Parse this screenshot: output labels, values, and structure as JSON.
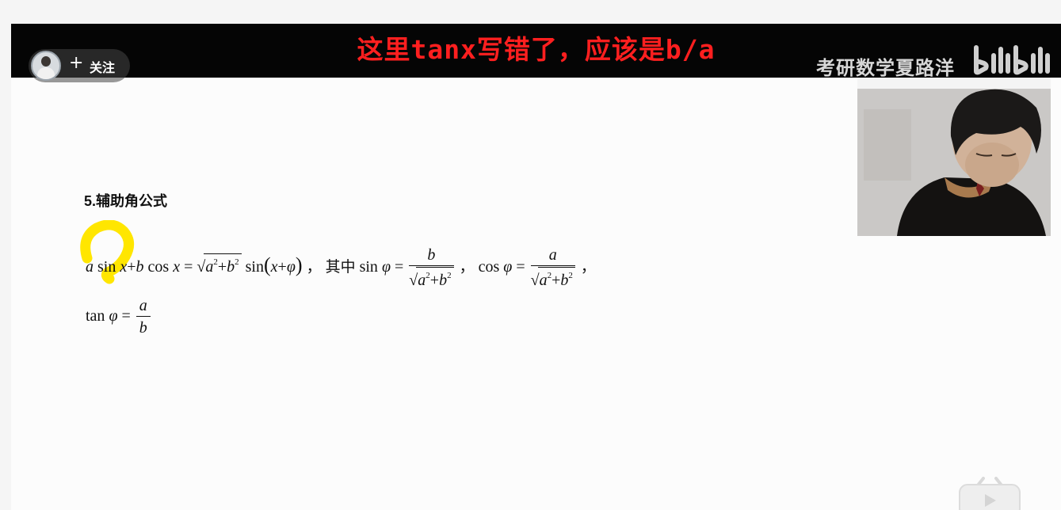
{
  "overlay": {
    "subtitle": "这里tanx写错了，应该是b/a",
    "follow_plus": "+",
    "follow_label": "关注",
    "watermark": "考研数学夏路洋",
    "logo_text": "bilibili"
  },
  "document": {
    "title": "5.辅助角公式",
    "formula_line1": {
      "a": "a",
      "sin1": "sin",
      "x1": "x",
      "plus1": "+",
      "b": "b",
      "cos1": "cos",
      "x2": "x",
      "eq1": "=",
      "a2": "a",
      "sq1": "2",
      "plus2": "+",
      "b2": "b",
      "sq2": "2",
      "sin2": "sin",
      "lparen": "(",
      "x3": "x",
      "plus3": "+",
      "phi1": "φ",
      "rparen": ")",
      "comma1": "，",
      "qizhong": "其中",
      "sin3": "sin",
      "phi2": "φ",
      "eq2": "=",
      "frac1_num": "b",
      "frac1_a": "a",
      "frac1_sq1": "2",
      "frac1_plus": "+",
      "frac1_b": "b",
      "frac1_sq2": "2",
      "comma2": "，",
      "cos2": "cos",
      "phi3": "φ",
      "eq3": "=",
      "frac2_num": "a",
      "frac2_a": "a",
      "frac2_sq1": "2",
      "frac2_plus": "+",
      "frac2_b": "b",
      "frac2_sq2": "2",
      "comma3": "，"
    },
    "formula_line2": {
      "tan": "tan",
      "phi": "φ",
      "eq": "=",
      "num": "a",
      "den": "b"
    }
  },
  "colors": {
    "subtitle": "#ff1f1f",
    "highlight": "#ffe600",
    "topbar": "#050505"
  },
  "icons": {
    "follow": "plus-icon",
    "highlight": "yellow-highlight-mark",
    "bottom": "tv-icon"
  }
}
